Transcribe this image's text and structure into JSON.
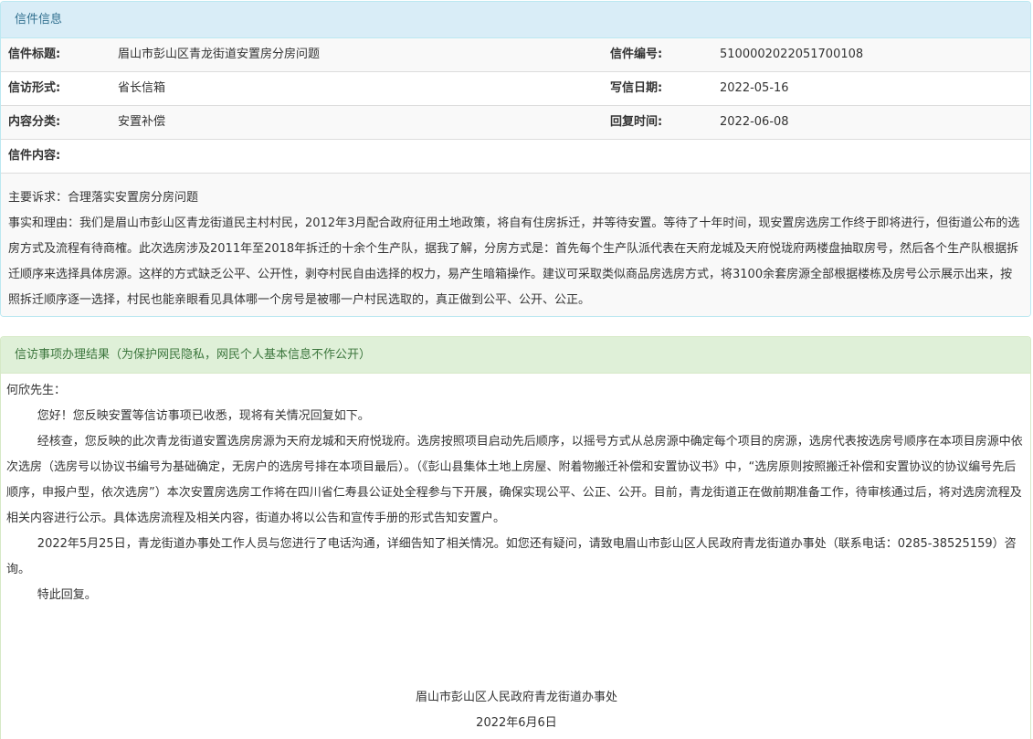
{
  "letter": {
    "heading": "信件信息",
    "title_label": "信件标题:",
    "title": "眉山市彭山区青龙街道安置房分房问题",
    "number_label": "信件编号:",
    "number": "5100002022051700108",
    "form_label": "信访形式:",
    "form": "省长信箱",
    "date_label": "写信日期:",
    "date": "2022-05-16",
    "category_label": "内容分类:",
    "category": "安置补偿",
    "reply_time_label": "回复时间:",
    "reply_time": "2022-06-08",
    "content_label": "信件内容:",
    "content": [
      "主要诉求：合理落实安置房分房问题",
      "事实和理由：我们是眉山市彭山区青龙街道民主村村民，2012年3月配合政府征用土地政策，将自有住房拆迁，并等待安置。等待了十年时间，现安置房选房工作终于即将进行，但街道公布的选房方式及流程有待商榷。此次选房涉及2011年至2018年拆迁的十余个生产队，据我了解，分房方式是：首先每个生产队派代表在天府龙城及天府悦珑府两楼盘抽取房号，然后各个生产队根据拆迁顺序来选择具体房源。这样的方式缺乏公平、公开性，剥夺村民自由选择的权力，易产生暗箱操作。建议可采取类似商品房选房方式，将3100余套房源全部根据楼栋及房号公示展示出来，按照拆迁顺序逐一选择，村民也能亲眼看见具体哪一个房号是被哪一户村民选取的，真正做到公平、公开、公正。"
    ]
  },
  "result": {
    "heading": "信访事项办理结果（为保护网民隐私，网民个人基本信息不作公开）",
    "salutation": "何欣先生：",
    "paragraphs": [
      "您好！您反映安置等信访事项已收悉，现将有关情况回复如下。",
      "经核查，您反映的此次青龙街道安置选房房源为天府龙城和天府悦珑府。选房按照项目启动先后顺序，以摇号方式从总房源中确定每个项目的房源，选房代表按选房号顺序在本项目房源中依次选房（选房号以协议书编号为基础确定，无房户的选房号排在本项目最后）。（《彭山县集体土地上房屋、附着物搬迁补偿和安置协议书》中，“选房原则按照搬迁补偿和安置协议的协议编号先后顺序，申报户型，依次选房”）本次安置房选房工作将在四川省仁寿县公证处全程参与下开展，确保实现公平、公正、公开。目前，青龙街道正在做前期准备工作，待审核通过后，将对选房流程及相关内容进行公示。具体选房流程及相关内容，街道办将以公告和宣传手册的形式告知安置户。",
      "2022年5月25日，青龙街道办事处工作人员与您进行了电话沟通，详细告知了相关情况。如您还有疑问，请致电眉山市彭山区人民政府青龙街道办事处（联系电话：0285-38525159）咨询。",
      "特此回复。"
    ],
    "signature": "眉山市彭山区人民政府青龙街道办事处",
    "sign_date": "2022年6月6日"
  }
}
